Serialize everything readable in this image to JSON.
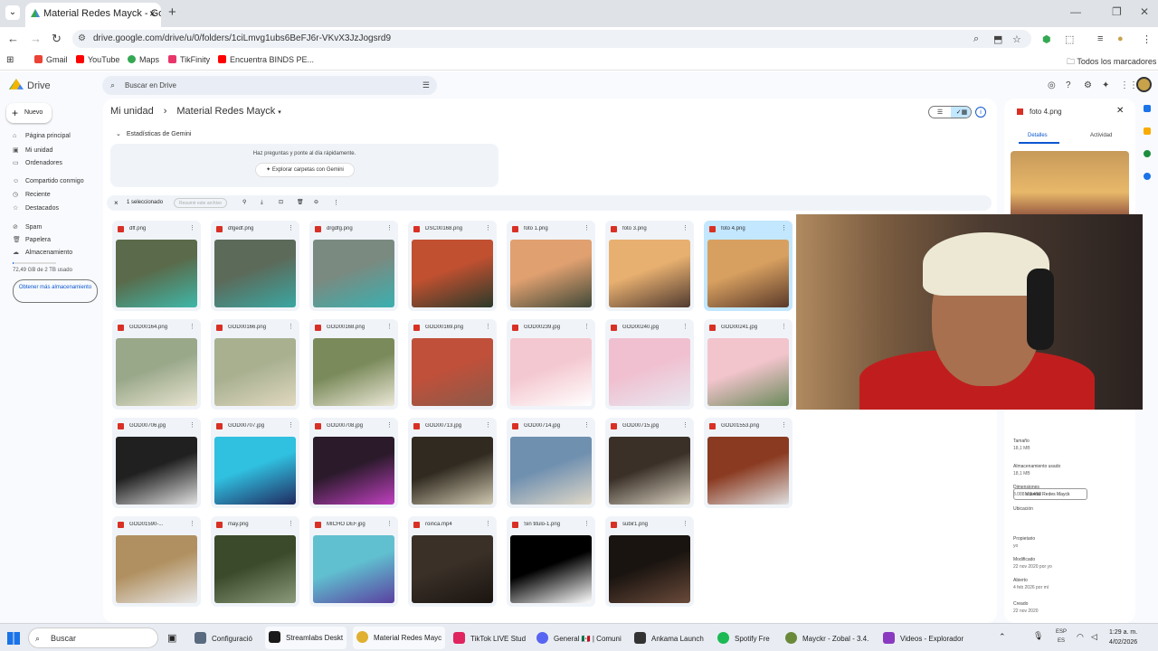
{
  "browser": {
    "tab_title": "Material Redes Mayck - Google",
    "url": "drive.google.com/drive/u/0/folders/1ciLmvg1ubs6BeFJ6r-VKvX3JzJogsrd9",
    "bookmarks": [
      "Gmail",
      "YouTube",
      "Maps",
      "TikFinity",
      "Encuentra BINDS PE..."
    ],
    "all_bookmarks": "Todos los marcadores"
  },
  "drive": {
    "logo_text": "Drive",
    "search_placeholder": "Buscar en Drive",
    "new_label": "Nuevo",
    "nav": [
      "Página principal",
      "Mi unidad",
      "Ordenadores",
      "Compartido conmigo",
      "Reciente",
      "Destacados",
      "Spam",
      "Papelera",
      "Almacenamiento"
    ],
    "storage_used_fraction": 0.025,
    "storage_text": "72,49 GB de 2 TB usado",
    "get_more": "Obtener más almacenamiento",
    "breadcrumb_root": "Mi unidad",
    "breadcrumb_folder": "Material Redes Mayck",
    "gemini_header": "Estadísticas de Gemini",
    "gemini_question": "Haz preguntas y ponte al día rápidamente.",
    "gemini_button": "Explorar carpetas con Gemini",
    "selection_count": "1 seleccionado",
    "selection_action": "Resumir este archivo",
    "files": [
      {
        "name": "dff.png",
        "colors": [
          "#5a6a4a",
          "#3fb7a8"
        ]
      },
      {
        "name": "dfgedf.png",
        "colors": [
          "#5c6a5a",
          "#3aa7a2"
        ]
      },
      {
        "name": "drgdfg.png",
        "colors": [
          "#7a8a80",
          "#3ab0b0"
        ]
      },
      {
        "name": "DSC00168.png",
        "colors": [
          "#c05030",
          "#2a3a2a"
        ]
      },
      {
        "name": "foto 1.png",
        "colors": [
          "#e0a070",
          "#404838"
        ]
      },
      {
        "name": "foto 3.png",
        "colors": [
          "#e8b070",
          "#503a30"
        ]
      },
      {
        "name": "foto 4.png",
        "colors": [
          "#d8a060",
          "#5a3a2a"
        ],
        "selected": true
      },
      {
        "name": "GOD00164.png",
        "colors": [
          "#9aa88a",
          "#e8e4d0"
        ]
      },
      {
        "name": "GOD00166.png",
        "colors": [
          "#a8b090",
          "#e0d8c0"
        ]
      },
      {
        "name": "GOD00168.png",
        "colors": [
          "#7a8a5a",
          "#ece8d8"
        ]
      },
      {
        "name": "GOD00169.png",
        "colors": [
          "#c0503a",
          "#8a5a4a"
        ]
      },
      {
        "name": "GOD00239.jpg",
        "colors": [
          "#f4c8d0",
          "#ffffff"
        ]
      },
      {
        "name": "GOD00240.jpg",
        "colors": [
          "#f0c0d0",
          "#e8e8f0"
        ]
      },
      {
        "name": "GOD00241.jpg",
        "colors": [
          "#f2c4cc",
          "#6a8a5a"
        ]
      },
      {
        "name": "GOD00706.jpg",
        "colors": [
          "#202020",
          "#e0e0e0"
        ]
      },
      {
        "name": "GOD00707.jpg",
        "colors": [
          "#30c0e0",
          "#202a60"
        ]
      },
      {
        "name": "GOD00708.jpg",
        "colors": [
          "#2a1a2a",
          "#c040c0"
        ]
      },
      {
        "name": "GOD00713.jpg",
        "colors": [
          "#302a20",
          "#d0c8b0"
        ]
      },
      {
        "name": "GOD00714.jpg",
        "colors": [
          "#7090b0",
          "#e0d8c8"
        ]
      },
      {
        "name": "GOD00715.jpg",
        "colors": [
          "#3a3028",
          "#d8d0c0"
        ]
      },
      {
        "name": "GOD01553.png",
        "colors": [
          "#8a3a20",
          "#e0e0e0"
        ]
      },
      {
        "name": "GOD01590-...",
        "colors": [
          "#b09060",
          "#e8e8e8"
        ]
      },
      {
        "name": "may.png",
        "colors": [
          "#3a4a2a",
          "#8a9a7a"
        ]
      },
      {
        "name": "MICHO DEF.jpg",
        "colors": [
          "#60c0d0",
          "#5a40a0"
        ]
      },
      {
        "name": "roinca.mp4",
        "colors": [
          "#3a3028",
          "#1a1410"
        ]
      },
      {
        "name": "Sin titulo-1.png",
        "colors": [
          "#000000",
          "#ffffff"
        ]
      },
      {
        "name": "subir1.png",
        "colors": [
          "#1a1410",
          "#6a4a3a"
        ]
      }
    ]
  },
  "details": {
    "title": "foto 4.png",
    "tab_details": "Detalles",
    "tab_activity": "Actividad",
    "fields": [
      {
        "label": "Tamaño",
        "value": "18,1 MB"
      },
      {
        "label": "Almacenamiento usado",
        "value": "18,1 MB"
      },
      {
        "label": "Dimensiones",
        "value": "3.088 x 5.490"
      },
      {
        "label": "Ubicación",
        "value": "Material Redes Mayck"
      },
      {
        "label": "Propietario",
        "value": "yo"
      },
      {
        "label": "Modificado",
        "value": "22 nov 2020 por yo"
      },
      {
        "label": "Abierto",
        "value": "4 feb 2026 por mí"
      },
      {
        "label": "Creado",
        "value": "22 nov 2020"
      },
      {
        "label": "Descripción",
        "value": ""
      }
    ]
  },
  "taskbar": {
    "search": "Buscar",
    "apps": [
      "Configuració",
      "Streamlabs Deskt",
      "Material Redes Mayc",
      "TikTok LIVE Stud",
      "General 🇲🇽 | Comuni",
      "Ankama Launch",
      "Spotify Fre",
      "Mayckr - Zobal - 3.4.",
      "Videos - Explorador"
    ],
    "lang": "ESP",
    "lang2": "ES",
    "time": "1:29 a. m.",
    "date": "4/02/2026"
  }
}
